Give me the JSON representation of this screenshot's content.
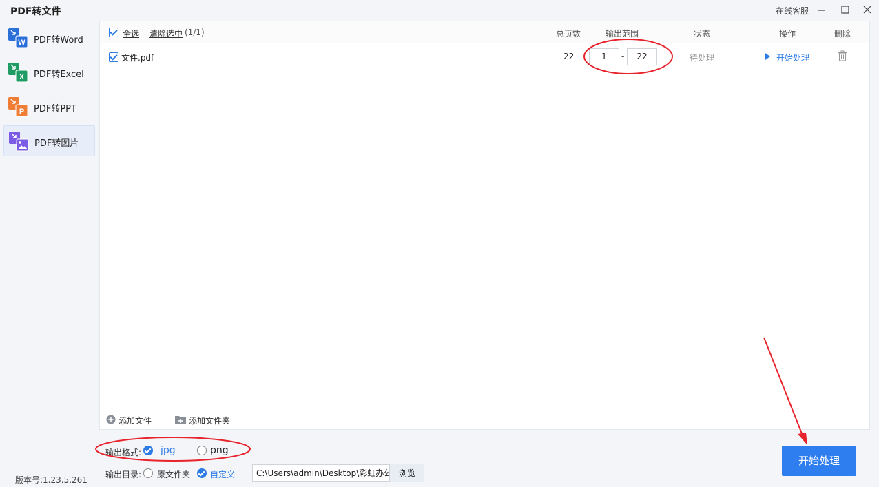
{
  "app": {
    "title": "PDF转文件",
    "support_label": "在线客服",
    "version_label": "版本号:1.23.5.261"
  },
  "sidebar": {
    "items": [
      {
        "label": "PDF转Word",
        "icon": "word-icon",
        "icon_letter": "W",
        "color": "#2b6fd9",
        "active": false
      },
      {
        "label": "PDF转Excel",
        "icon": "excel-icon",
        "icon_letter": "X",
        "color": "#1e9c63",
        "active": false
      },
      {
        "label": "PDF转PPT",
        "icon": "ppt-icon",
        "icon_letter": "P",
        "color": "#f07d36",
        "active": false
      },
      {
        "label": "PDF转图片",
        "icon": "image-icon",
        "icon_letter": "",
        "color": "#7c5ce6",
        "active": true
      }
    ]
  },
  "table": {
    "select_all": "全选",
    "clear_selection": "清除选中",
    "selection_count": "(1/1)",
    "columns": {
      "pages": "总页数",
      "range": "输出范围",
      "status": "状态",
      "action": "操作",
      "delete": "删除"
    },
    "rows": [
      {
        "filename": "文件.pdf",
        "pages": "22",
        "range_start": "1",
        "range_sep": "-",
        "range_end": "22",
        "status": "待处理",
        "action": "开始处理"
      }
    ]
  },
  "footer_actions": {
    "add_file": "添加文件",
    "add_folder": "添加文件夹"
  },
  "settings": {
    "format_label": "输出格式:",
    "format_options": [
      "jpg",
      "png"
    ],
    "format_selected": "jpg",
    "output_dir_label": "输出目录:",
    "dir_options": [
      "原文件夹",
      "自定义"
    ],
    "dir_selected": "自定义",
    "path_value": "C:\\Users\\admin\\Desktop\\彩虹办公",
    "browse_label": "浏览"
  },
  "start_button": "开始处理",
  "colors": {
    "accent": "#2f7ef0",
    "annotation": "#e8232b"
  }
}
